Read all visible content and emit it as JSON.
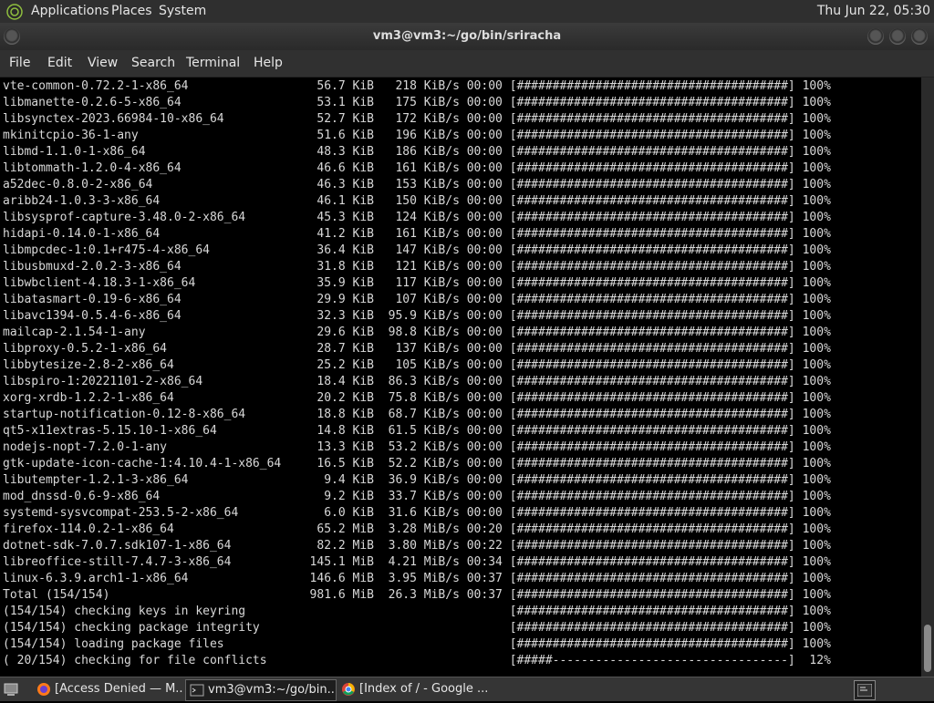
{
  "top_panel": {
    "menus": [
      "Applications",
      "Places",
      "System"
    ],
    "clock": "Thu Jun 22, 05:30"
  },
  "window": {
    "title": "vm3@vm3:~/go/bin/sriracha",
    "menu": [
      "File",
      "Edit",
      "View",
      "Search",
      "Terminal",
      "Help"
    ]
  },
  "terminal": {
    "lines": [
      "vte-common-0.72.2-1-x86_64                  56.7 KiB   218 KiB/s 00:00 [######################################] 100%",
      "libmanette-0.2.6-5-x86_64                   53.1 KiB   175 KiB/s 00:00 [######################################] 100%",
      "libsynctex-2023.66984-10-x86_64             52.7 KiB   172 KiB/s 00:00 [######################################] 100%",
      "mkinitcpio-36-1-any                         51.6 KiB   196 KiB/s 00:00 [######################################] 100%",
      "libmd-1.1.0-1-x86_64                        48.3 KiB   186 KiB/s 00:00 [######################################] 100%",
      "libtommath-1.2.0-4-x86_64                   46.6 KiB   161 KiB/s 00:00 [######################################] 100%",
      "a52dec-0.8.0-2-x86_64                       46.3 KiB   153 KiB/s 00:00 [######################################] 100%",
      "aribb24-1.0.3-3-x86_64                      46.1 KiB   150 KiB/s 00:00 [######################################] 100%",
      "libsysprof-capture-3.48.0-2-x86_64          45.3 KiB   124 KiB/s 00:00 [######################################] 100%",
      "hidapi-0.14.0-1-x86_64                      41.2 KiB   161 KiB/s 00:00 [######################################] 100%",
      "libmpcdec-1:0.1+r475-4-x86_64               36.4 KiB   147 KiB/s 00:00 [######################################] 100%",
      "libusbmuxd-2.0.2-3-x86_64                   31.8 KiB   121 KiB/s 00:00 [######################################] 100%",
      "libwbclient-4.18.3-1-x86_64                 35.9 KiB   117 KiB/s 00:00 [######################################] 100%",
      "libatasmart-0.19-6-x86_64                   29.9 KiB   107 KiB/s 00:00 [######################################] 100%",
      "libavc1394-0.5.4-6-x86_64                   32.3 KiB  95.9 KiB/s 00:00 [######################################] 100%",
      "mailcap-2.1.54-1-any                        29.6 KiB  98.8 KiB/s 00:00 [######################################] 100%",
      "libproxy-0.5.2-1-x86_64                     28.7 KiB   137 KiB/s 00:00 [######################################] 100%",
      "libbytesize-2.8-2-x86_64                    25.2 KiB   105 KiB/s 00:00 [######################################] 100%",
      "libspiro-1:20221101-2-x86_64                18.4 KiB  86.3 KiB/s 00:00 [######################################] 100%",
      "xorg-xrdb-1.2.2-1-x86_64                    20.2 KiB  75.8 KiB/s 00:00 [######################################] 100%",
      "startup-notification-0.12-8-x86_64          18.8 KiB  68.7 KiB/s 00:00 [######################################] 100%",
      "qt5-x11extras-5.15.10-1-x86_64              14.8 KiB  61.5 KiB/s 00:00 [######################################] 100%",
      "nodejs-nopt-7.2.0-1-any                     13.3 KiB  53.2 KiB/s 00:00 [######################################] 100%",
      "gtk-update-icon-cache-1:4.10.4-1-x86_64     16.5 KiB  52.2 KiB/s 00:00 [######################################] 100%",
      "libutempter-1.2.1-3-x86_64                   9.4 KiB  36.9 KiB/s 00:00 [######################################] 100%",
      "mod_dnssd-0.6-9-x86_64                       9.2 KiB  33.7 KiB/s 00:00 [######################################] 100%",
      "systemd-sysvcompat-253.5-2-x86_64            6.0 KiB  31.6 KiB/s 00:00 [######################################] 100%",
      "firefox-114.0.2-1-x86_64                    65.2 MiB  3.28 MiB/s 00:20 [######################################] 100%",
      "dotnet-sdk-7.0.7.sdk107-1-x86_64            82.2 MiB  3.80 MiB/s 00:22 [######################################] 100%",
      "libreoffice-still-7.4.7-3-x86_64           145.1 MiB  4.21 MiB/s 00:34 [######################################] 100%",
      "linux-6.3.9.arch1-1-x86_64                 146.6 MiB  3.95 MiB/s 00:37 [######################################] 100%",
      "Total (154/154)                            981.6 MiB  26.3 MiB/s 00:37 [######################################] 100%",
      "(154/154) checking keys in keyring                                     [######################################] 100%",
      "(154/154) checking package integrity                                   [######################################] 100%",
      "(154/154) loading package files                                        [######################################] 100%",
      "( 20/154) checking for file conflicts                                  [#####---------------------------------]  12%"
    ]
  },
  "taskbar": {
    "items": [
      {
        "label": "[Access Denied — M...",
        "icon": "firefox-icon"
      },
      {
        "label": "vm3@vm3:~/go/bin...",
        "icon": "terminal-icon"
      },
      {
        "label": "[Index of / - Google ...",
        "icon": "chrome-icon"
      }
    ]
  }
}
